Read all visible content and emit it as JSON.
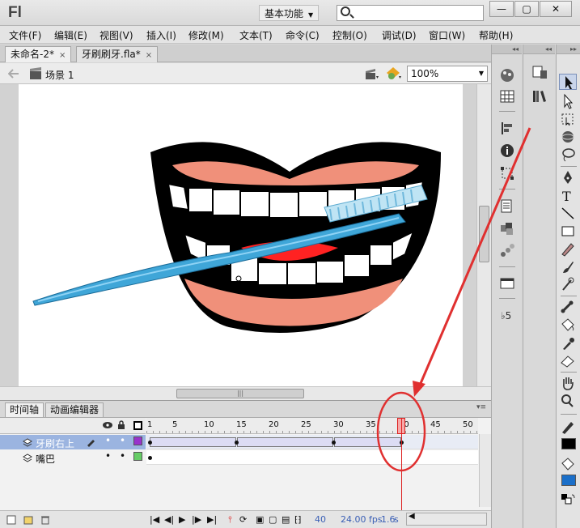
{
  "app": {
    "logo": "Fl",
    "workspace": "基本功能",
    "search_placeholder": ""
  },
  "window_buttons": {
    "minimize": "—",
    "maximize": "▢",
    "close": "✕"
  },
  "menu": [
    "文件(F)",
    "编辑(E)",
    "视图(V)",
    "插入(I)",
    "修改(M)",
    "文本(T)",
    "命令(C)",
    "控制(O)",
    "调试(D)",
    "窗口(W)",
    "帮助(H)"
  ],
  "tabs": [
    {
      "label": "未命名-2*",
      "close": "×"
    },
    {
      "label": "牙刷刷牙.fla*",
      "close": "×"
    }
  ],
  "scene": {
    "label": "场景 1",
    "zoom": "100%"
  },
  "timeline": {
    "tabs": [
      "时间轴",
      "动画编辑器"
    ],
    "ruler_labels": [
      "1",
      "5",
      "10",
      "15",
      "20",
      "25",
      "30",
      "35",
      "40",
      "45",
      "50"
    ],
    "layers": [
      {
        "name": "牙刷右上",
        "selected": true,
        "color": "#9933cc"
      },
      {
        "name": "嘴巴",
        "selected": false,
        "color": "#66cc66"
      }
    ],
    "current_frame": "40",
    "fps": "24.00",
    "fps_unit": "fps",
    "time": "1.6",
    "time_unit": "s"
  },
  "colors": {
    "accent": "#d22222",
    "stroke_swatch": "#000000",
    "fill_swatch": "#1a6fc9"
  },
  "icons": [
    "paint-icon",
    "grid-icon",
    "align-icon",
    "info-icon",
    "transform-icon",
    "swatches-icon",
    "components-icon",
    "motion-presets-icon",
    "library-icon",
    "selection-tool-icon",
    "subselection-tool-icon",
    "free-transform-tool-icon",
    "3d-rotation-tool-icon",
    "lasso-tool-icon",
    "pen-tool-icon",
    "text-tool-icon",
    "line-tool-icon",
    "rectangle-tool-icon",
    "pencil-tool-icon",
    "brush-tool-icon",
    "deco-tool-icon",
    "bone-tool-icon",
    "paint-bucket-tool-icon",
    "eyedropper-tool-icon",
    "eraser-tool-icon",
    "hand-tool-icon",
    "zoom-tool-icon",
    "eye-icon",
    "lock-icon",
    "outline-icon"
  ]
}
